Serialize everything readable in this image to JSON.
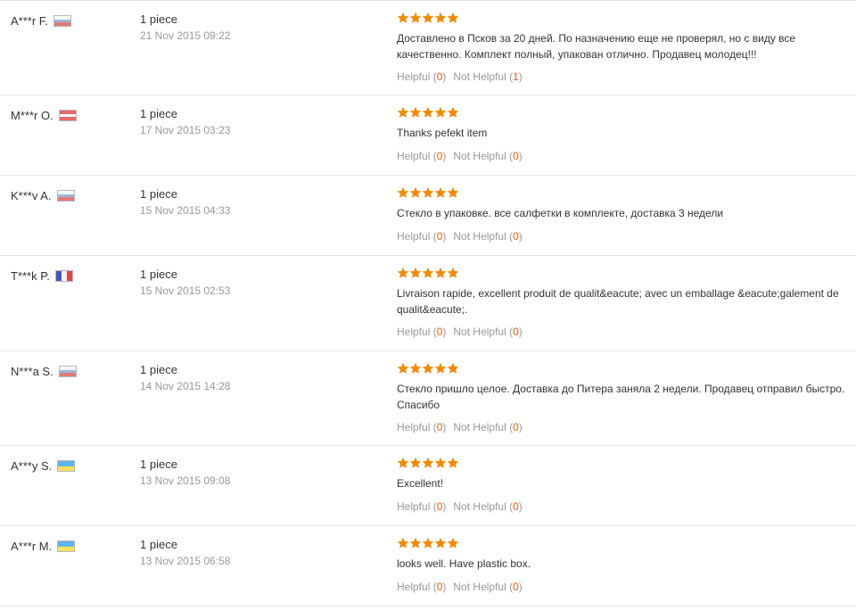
{
  "labels": {
    "helpful": "Helpful",
    "not_helpful": "Not Helpful"
  },
  "colors": {
    "star": "#f28a00",
    "vote_count": "#e8600a",
    "muted": "#999999",
    "text": "#333333",
    "divider": "#e5e5e5"
  },
  "reviews": [
    {
      "buyer": "A***r F.",
      "flag": "ru-flag-icon",
      "quantity": "1 piece",
      "date": "21 Nov 2015 09:22",
      "rating": 5,
      "text": "Доставлено в Псков за 20 дней. По назначению еще не проверял, но с виду все качественно. Комплект полный, упакован отлично. Продавец молодец!!!",
      "helpful_count": "0",
      "not_helpful_count": "1"
    },
    {
      "buyer": "M***r O.",
      "flag": "at-flag-icon",
      "quantity": "1 piece",
      "date": "17 Nov 2015 03:23",
      "rating": 5,
      "text": "Thanks pefekt item",
      "helpful_count": "0",
      "not_helpful_count": "0"
    },
    {
      "buyer": "K***v A.",
      "flag": "ru-flag-icon",
      "quantity": "1 piece",
      "date": "15 Nov 2015 04:33",
      "rating": 5,
      "text": "Стекло в упаковке. все салфетки в комплекте, доставка 3 недели",
      "helpful_count": "0",
      "not_helpful_count": "0"
    },
    {
      "buyer": "T***k P.",
      "flag": "fr-flag-icon",
      "quantity": "1 piece",
      "date": "15 Nov 2015 02:53",
      "rating": 5,
      "text": "Livraison rapide, excellent produit de qualit&eacute; avec un emballage &eacute;galement de qualit&eacute;.",
      "helpful_count": "0",
      "not_helpful_count": "0"
    },
    {
      "buyer": "N***a S.",
      "flag": "ru-flag-icon",
      "quantity": "1 piece",
      "date": "14 Nov 2015 14:28",
      "rating": 5,
      "text": "Стекло пришло целое. Доставка до Питера заняла 2 недели. Продавец отправил быстро. Спасибо",
      "helpful_count": "0",
      "not_helpful_count": "0"
    },
    {
      "buyer": "A***y S.",
      "flag": "ua-flag-icon",
      "quantity": "1 piece",
      "date": "13 Nov 2015 09:08",
      "rating": 5,
      "text": "Excellent!",
      "helpful_count": "0",
      "not_helpful_count": "0"
    },
    {
      "buyer": "A***r M.",
      "flag": "ua-flag-icon",
      "quantity": "1 piece",
      "date": "13 Nov 2015 06:58",
      "rating": 5,
      "text": "looks well. Have plastic box.",
      "helpful_count": "0",
      "not_helpful_count": "0"
    }
  ]
}
